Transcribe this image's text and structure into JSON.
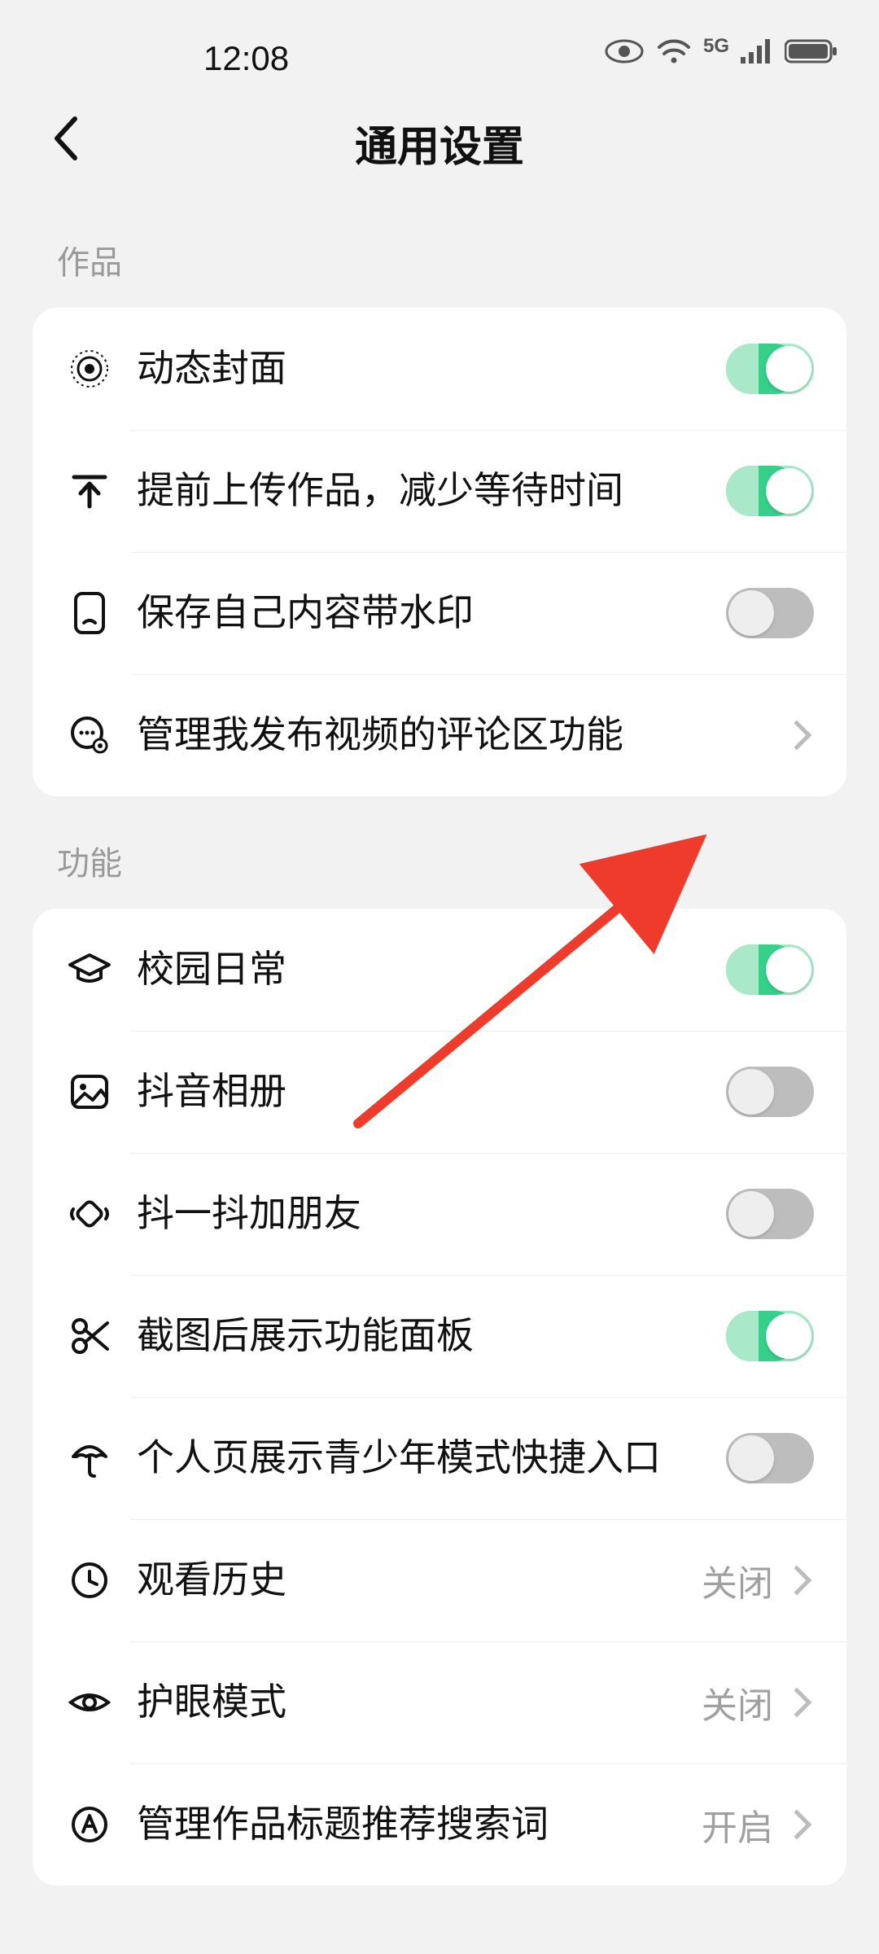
{
  "status": {
    "time": "12:08",
    "network_label": "5G"
  },
  "header": {
    "title": "通用设置"
  },
  "sections": {
    "works": {
      "label": "作品",
      "dynamic_cover": "动态封面",
      "pre_upload": "提前上传作品，减少等待时间",
      "save_watermark": "保存自己内容带水印",
      "manage_comments": "管理我发布视频的评论区功能"
    },
    "features": {
      "label": "功能",
      "campus_daily": "校园日常",
      "douyin_album": "抖音相册",
      "shake_friend": "抖一抖加朋友",
      "screenshot_panel": "截图后展示功能面板",
      "teen_shortcut": "个人页展示青少年模式快捷入口",
      "watch_history": "观看历史",
      "watch_history_value": "关闭",
      "eye_care": "护眼模式",
      "eye_care_value": "关闭",
      "manage_keywords": "管理作品标题推荐搜索词",
      "manage_keywords_value": "开启"
    }
  },
  "toggles": {
    "dynamic_cover": true,
    "pre_upload": true,
    "save_watermark": false,
    "campus_daily": true,
    "douyin_album": false,
    "shake_friend": false,
    "screenshot_panel": true,
    "teen_shortcut": false
  }
}
